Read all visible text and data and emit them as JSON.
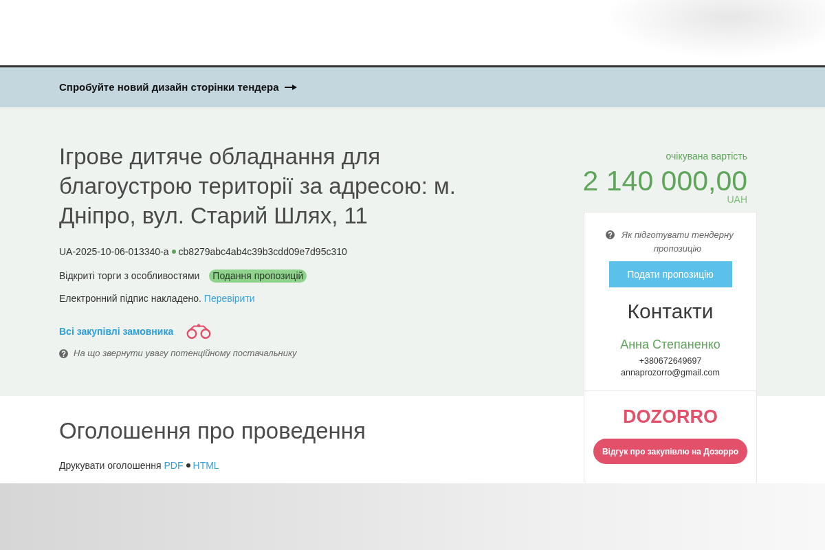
{
  "banner": {
    "text": "Спробуйте новий дизайн сторінки тендера"
  },
  "tender": {
    "title": "Ігрове дитяче обладнання для благоустрою території за адресою: м. Дніпро, вул. Старий Шлях, 11",
    "tender_id": "UA-2025-10-06-013340-a",
    "hash": "cb8279abc4ab4c39b3cdd09e7d95c310",
    "procedure": "Відкриті торги з особливостями",
    "status": "Подання пропозицій",
    "signature": {
      "text": "Електронний підпис накладено.",
      "link": "Перевірити"
    },
    "buyer_link": "Всі закупівлі замовника",
    "hint": "На що звернути увагу потенційному постачальнику"
  },
  "value": {
    "label": "очікувана вартість",
    "amount": "2 140 000,00",
    "currency": "UAH"
  },
  "sidebar": {
    "help_link": "Як підготувати тендерну пропозицію",
    "submit_button": "Подати пропозицію",
    "contacts": {
      "heading": "Контакти",
      "name": "Анна Степаненко",
      "phone": "+380672649697",
      "email": "annaprozorro@gmail.com"
    },
    "feedback": {
      "logo": "DOZORRO",
      "button": "Відгук про закупівлю на Дозорро"
    }
  },
  "announcement": {
    "heading": "Оголошення про проведення",
    "print_label": "Друкувати оголошення",
    "formats": [
      "PDF",
      "HTML"
    ]
  }
}
